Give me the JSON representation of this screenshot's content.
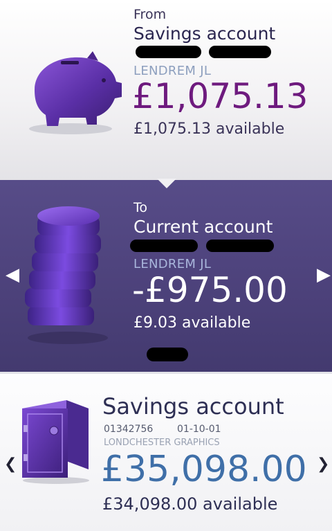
{
  "from": {
    "label": "From",
    "account_type": "Savings account",
    "owner": "LENDREM JL",
    "balance": "£1,075.13",
    "available": "£1,075.13 available",
    "icon": "piggy-bank-icon"
  },
  "to": {
    "label": "To",
    "account_type": "Current account",
    "owner": "LENDREM JL",
    "balance": "-£975.00",
    "available": "£9.03 available",
    "icon": "coin-stack-icon"
  },
  "savings_card": {
    "account_type": "Savings account",
    "account_number": "01342756",
    "sort_code": "01-10-01",
    "account_name": "LONDCHESTER GRAPHICS",
    "balance": "£35,098.00",
    "available": "£34,098.00 available",
    "icon": "safe-icon"
  },
  "navigation": {
    "prev_icon": "chevron-left-icon",
    "next_icon": "chevron-right-icon"
  },
  "colors": {
    "from_balance": "#6e1a7e",
    "to_panel_bg": "#4c417a",
    "savings_balance": "#3f6fa8"
  }
}
